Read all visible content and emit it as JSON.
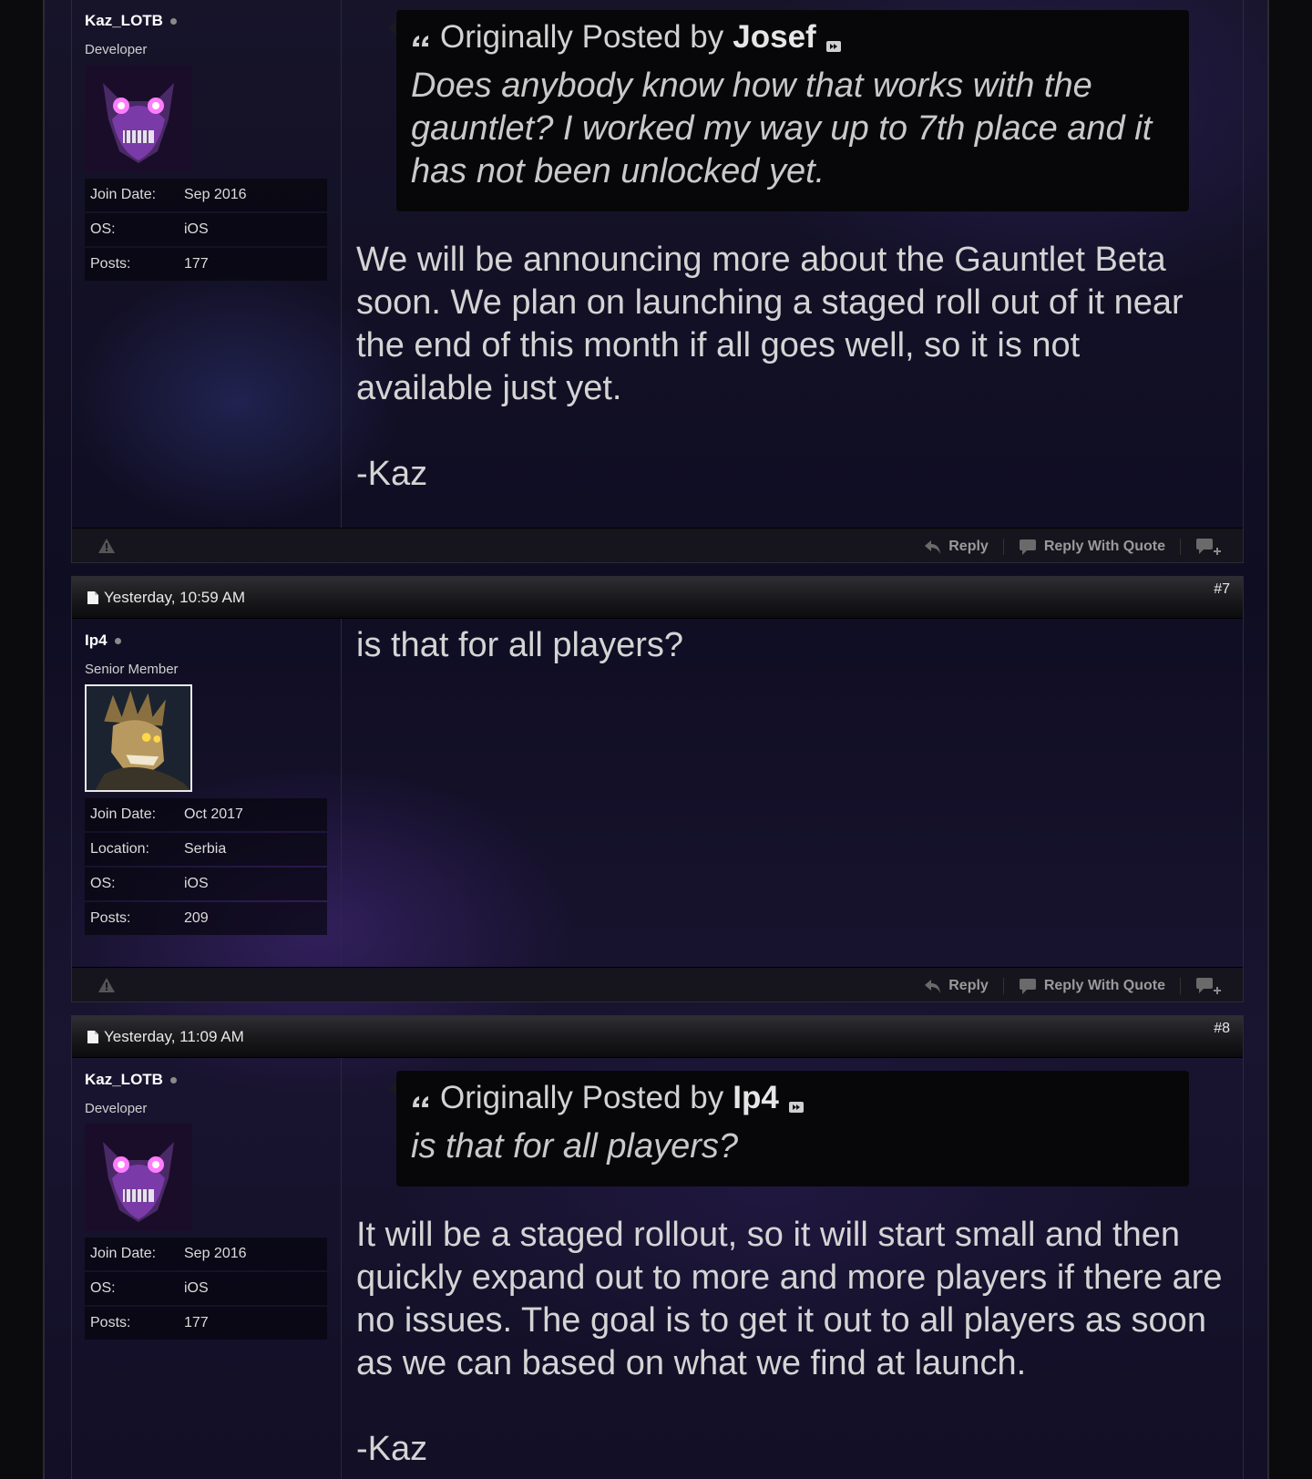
{
  "posts": [
    {
      "date": "",
      "number": "",
      "user": {
        "name": "Kaz_LOTB",
        "title": "Developer",
        "stats": [
          {
            "label": "Join Date:",
            "value": "Sep 2016"
          },
          {
            "label": "OS:",
            "value": "iOS"
          },
          {
            "label": "Posts:",
            "value": "177"
          }
        ]
      },
      "quote": {
        "prefix": "Originally Posted by",
        "author": "Josef",
        "text": "Does anybody know how that works with the gauntlet? I worked my way up to 7th place and it has not been unlocked yet."
      },
      "message": "We will be announcing more about the Gauntlet Beta soon. We plan on launching a staged roll out of it near the end of this month if all goes well, so it is not available just yet.",
      "signoff": "-Kaz"
    },
    {
      "date": "Yesterday, 10:59 AM",
      "number": "#7",
      "user": {
        "name": "Ip4",
        "title": "Senior Member",
        "stats": [
          {
            "label": "Join Date:",
            "value": "Oct 2017"
          },
          {
            "label": "Location:",
            "value": "Serbia"
          },
          {
            "label": "OS:",
            "value": "iOS"
          },
          {
            "label": "Posts:",
            "value": "209"
          }
        ]
      },
      "message": "is that for all players?"
    },
    {
      "date": "Yesterday, 11:09 AM",
      "number": "#8",
      "user": {
        "name": "Kaz_LOTB",
        "title": "Developer",
        "stats": [
          {
            "label": "Join Date:",
            "value": "Sep 2016"
          },
          {
            "label": "OS:",
            "value": "iOS"
          },
          {
            "label": "Posts:",
            "value": "177"
          }
        ]
      },
      "quote": {
        "prefix": "Originally Posted by",
        "author": "Ip4",
        "text": "is that for all players?"
      },
      "message": "It will be a staged rollout, so it will start small and then quickly expand out to more and more players if there are no issues. The goal is to get it out to all players as soon as we can based on what we find at launch.",
      "signoff": "-Kaz"
    }
  ],
  "footer": {
    "reply_label": "Reply",
    "reply_quote_label": "Reply With Quote"
  },
  "icons": [
    "document-icon",
    "online-status-icon",
    "quote-icon",
    "view-post-icon",
    "report-warning-icon",
    "reply-icon",
    "reply-with-quote-icon",
    "multi-quote-icon"
  ]
}
